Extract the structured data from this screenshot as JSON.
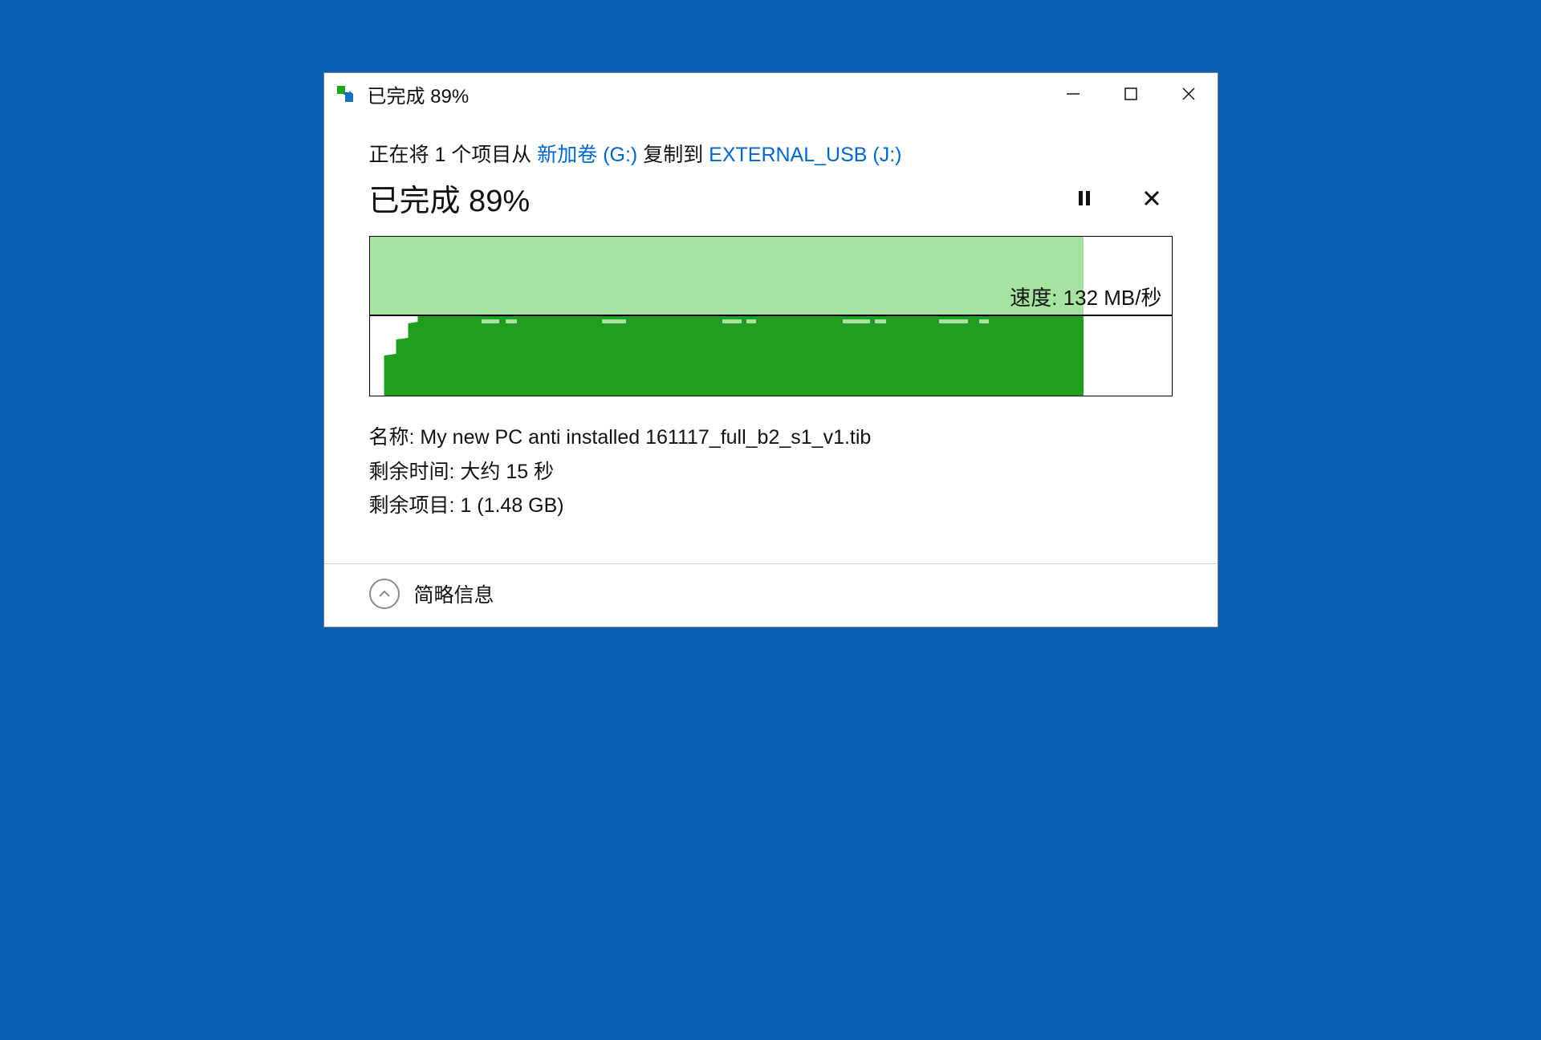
{
  "window": {
    "title": "已完成 89%"
  },
  "copy_line": {
    "prefix": "正在将 1 个项目从 ",
    "source": "新加卷 (G:)",
    "middle": " 复制到 ",
    "destination": "EXTERNAL_USB (J:)"
  },
  "progress": {
    "heading": "已完成 89%",
    "percent": 89
  },
  "speed": {
    "label_prefix": "速度: ",
    "value": "132 MB/秒",
    "level_percent": 50
  },
  "details": {
    "name_label": "名称: ",
    "name_value": "My new PC anti installed 161117_full_b2_s1_v1.tib",
    "time_label": "剩余时间: ",
    "time_value": "大约 15 秒",
    "items_label": "剩余项目: ",
    "items_value": "1 (1.48 GB)"
  },
  "footer": {
    "toggle_label": "简略信息"
  },
  "chart_data": {
    "type": "area",
    "title": "Transfer speed over time",
    "xlabel": "",
    "ylabel": "速度 (MB/秒)",
    "ylim": [
      0,
      264
    ],
    "x_range_percent": [
      0,
      100
    ],
    "current_speed_mb_s": 132,
    "progress_percent": 89,
    "series": [
      {
        "name": "speed",
        "x_percent": [
          0,
          1,
          2,
          3,
          4,
          5,
          6,
          89
        ],
        "y_mb_s": [
          0,
          40,
          70,
          100,
          118,
          128,
          132,
          132
        ]
      }
    ],
    "annotations": [
      {
        "text": "速度: 132 MB/秒",
        "x_percent": 95,
        "y_mb_s": 170
      }
    ]
  }
}
